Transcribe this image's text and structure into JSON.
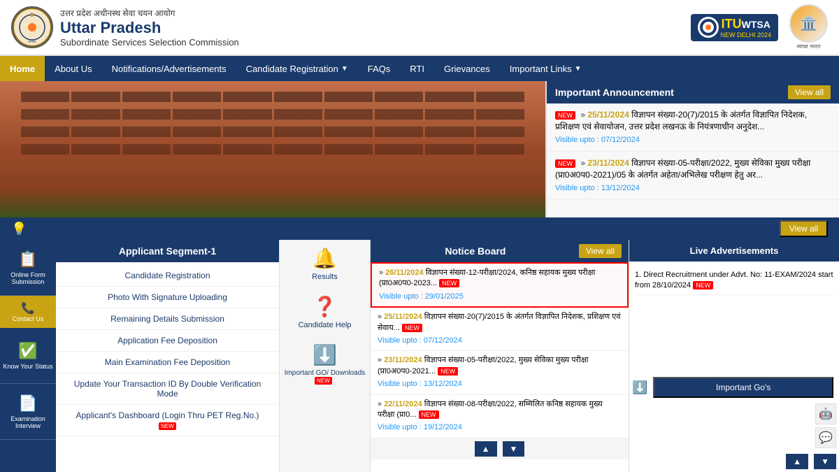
{
  "header": {
    "hindi_text": "उत्तर प्रदेश अधीनस्थ सेवा चयन आयोग",
    "main_title": "Uttar Pradesh",
    "subtitle": "Subordinate Services Selection Commission",
    "itu_label": "ITU",
    "wtsa_label": "WTSA",
    "new_delhi_label": "NEW DELHI 2024",
    "swachh_label": "स्वच्छ भारत"
  },
  "nav": {
    "items": [
      {
        "label": "Home",
        "active": true
      },
      {
        "label": "About Us",
        "active": false
      },
      {
        "label": "Notifications/Advertisements",
        "active": false
      },
      {
        "label": "Candidate Registration",
        "active": false,
        "has_arrow": true
      },
      {
        "label": "FAQs",
        "active": false
      },
      {
        "label": "RTI",
        "active": false
      },
      {
        "label": "Grievances",
        "active": false
      },
      {
        "label": "Important Links",
        "active": false,
        "has_arrow": true
      }
    ]
  },
  "announcements": {
    "header": "Important Announcement",
    "view_all": "View all",
    "items": [
      {
        "date": "25/11/2024",
        "text": "विज्ञापन संख्या-20(7)/2015 के अंतर्गत विज्ञापित निदेशक, प्रशिक्षण एवं सेवायोजन, उत्तर प्रदेश लखनऊ के नियंत्रणाधीन अनुदेश...",
        "visible": "Visible upto : 07/12/2024",
        "is_new": true
      },
      {
        "date": "23/11/2024",
        "text": "विज्ञापन संख्या-05-परीक्षा/2022, मुख्य सेविका मुख्य परीक्षा (प्रा0अ0प0-2021)/05 के अंतर्गत अहेता/अभिलेख परीक्षण हेतु अर...",
        "visible": "Visible upto : 13/12/2024",
        "is_new": true
      }
    ]
  },
  "bottom_banner": {
    "view_all": "View all"
  },
  "left_sidebar": {
    "items": [
      {
        "icon": "📋",
        "label": "Online Form Submission"
      },
      {
        "icon": "✅",
        "label": "Know Your Status"
      },
      {
        "icon": "📄",
        "label": "Examination Interview"
      }
    ],
    "contact_label": "Contact Us"
  },
  "applicant_segment": {
    "header": "Applicant Segment-1",
    "items": [
      {
        "label": "Candidate Registration",
        "is_new": false
      },
      {
        "label": "Photo With Signature Uploading",
        "is_new": false
      },
      {
        "label": "Remaining Details Submission",
        "is_new": false
      },
      {
        "label": "Application Fee Deposition",
        "is_new": false
      },
      {
        "label": "Main Examination Fee Deposition",
        "is_new": false
      },
      {
        "label": "Update Your Transaction ID By Double Verification Mode",
        "is_new": false
      },
      {
        "label": "Applicant's Dashboard (Login Thru PET Reg.No.)",
        "is_new": true
      }
    ]
  },
  "results_column": {
    "items": [
      {
        "icon": "🔔",
        "label": "Results"
      },
      {
        "icon": "❓",
        "label": "Candidate Help"
      },
      {
        "icon": "⬇",
        "label": "Important GO/ Downloads"
      }
    ]
  },
  "notice_board": {
    "header": "Notice Board",
    "view_all": "View all",
    "items": [
      {
        "date": "26/11/2024",
        "text": "विज्ञापन संख्या-12-परीक्षा/2024, कनिष्ठ सहायक मुख्य परीक्षा (प्रा0अ0प0-2023...",
        "visible": "Visible upto : 29/01/2025",
        "is_new": true,
        "highlighted": true
      },
      {
        "date": "25/11/2024",
        "text": "विज्ञापन संख्या-20(7)/2015 के अंतर्गत विज्ञापित निदेशक, प्रशिक्षण एवं सेवाय...",
        "visible": "Visible upto : 07/12/2024",
        "is_new": true,
        "highlighted": false
      },
      {
        "date": "23/11/2024",
        "text": "विज्ञापन संख्या-05-परीक्षा/2022, मुख्य सेविका मुख्य परीक्षा (प्रा0अ0प0-2021...",
        "visible": "Visible upto : 13/12/2024",
        "is_new": true,
        "highlighted": false
      },
      {
        "date": "22/11/2024",
        "text": "विज्ञापन संख्या-08-परीक्षा/2022, सम्मिलित कनिष्ठ सहायक मुख्य परीक्षा (प्रा0...",
        "visible": "Visible upto : 19/12/2024",
        "is_new": true,
        "highlighted": false
      }
    ],
    "nav_up": "▲",
    "nav_down": "▼"
  },
  "live_ads": {
    "header": "Live Advertisements",
    "items": [
      {
        "number": "1.",
        "text": "Direct Recruitment under Advt. No: 11-EXAM/2024 start from 28/10/2024",
        "is_new": true
      }
    ],
    "important_gos_label": "Important Go's",
    "nav_up": "▲",
    "nav_down": "▼"
  }
}
